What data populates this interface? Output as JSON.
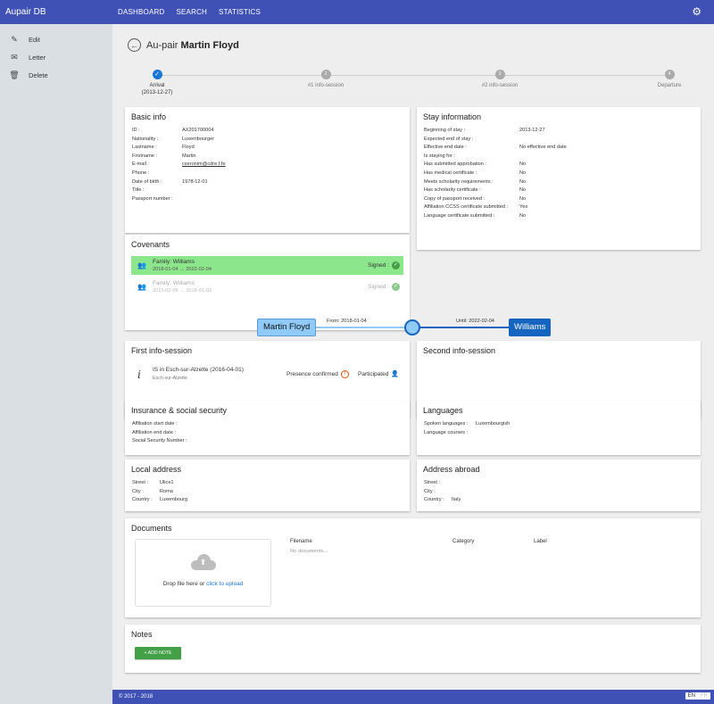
{
  "app": {
    "title": "Aupair DB"
  },
  "nav": [
    "DASHBOARD",
    "SEARCH",
    "STATISTICS"
  ],
  "sidebar": [
    {
      "label": "Edit",
      "icon": "pencil-icon"
    },
    {
      "label": "Letter",
      "icon": "envelope-icon"
    },
    {
      "label": "Delete",
      "icon": "trash-icon"
    }
  ],
  "page": {
    "prefix": "Au-pair",
    "name": "Martin Floyd"
  },
  "steps": [
    {
      "label": "Arrival",
      "sub": "(2013-12-27)",
      "num": "✓",
      "active": true
    },
    {
      "label": "#1 info-session",
      "sub": "",
      "num": "2",
      "active": false
    },
    {
      "label": "#2 info-session",
      "sub": "",
      "num": "3",
      "active": false
    },
    {
      "label": "Departure",
      "sub": "",
      "num": "4",
      "active": false
    }
  ],
  "basic": {
    "title": "Basic info",
    "rows": [
      {
        "k": "ID :",
        "v": "AX201700004"
      },
      {
        "k": "Nationality :",
        "v": "Luxembourger"
      },
      {
        "k": "Lastname :",
        "v": "Floyd"
      },
      {
        "k": "Firstname :",
        "v": "Martin"
      },
      {
        "k": "E-mail :",
        "v": "cseronim@cdre.f.fe",
        "link": true
      },
      {
        "k": "Phone :",
        "v": ""
      },
      {
        "k": "Date of birth :",
        "v": "1978-12-01"
      },
      {
        "k": "Title :",
        "v": ""
      },
      {
        "k": "Passport number :",
        "v": ""
      }
    ]
  },
  "stay": {
    "title": "Stay information",
    "rows": [
      {
        "k": "Beginning of stay :",
        "v": "2013-12-27"
      },
      {
        "k": "Expected end of stay :",
        "v": ""
      },
      {
        "k": "Effective end date :",
        "v": "No effective end date",
        "red": true
      },
      {
        "k": "Is staying for :",
        "v": ""
      },
      {
        "k": "Has submitted approbation :",
        "v": "No",
        "red": true
      },
      {
        "k": "Has medical certificate :",
        "v": "No",
        "red": true
      },
      {
        "k": "Meets scholarity requirements :",
        "v": "No",
        "red": true
      },
      {
        "k": "Has scholarity certificate :",
        "v": "No",
        "red": true
      },
      {
        "k": "Copy of passport received :",
        "v": "No",
        "red": true
      },
      {
        "k": "Affiliation CCSS certificate submitted :",
        "v": "Yes"
      },
      {
        "k": "Language certificate submitted :",
        "v": "No",
        "red": true
      }
    ]
  },
  "covenants": {
    "title": "Covenants",
    "items": [
      {
        "family": "Family: Williams",
        "dates": "2018-01-04 → 2022-02-04",
        "status": "Signed :",
        "active": true
      },
      {
        "family": "Family: Williams",
        "dates": "2015-02-06 → 2018-01-03",
        "status": "Signed :",
        "active": false
      }
    ]
  },
  "timeline": {
    "left": "Martin Floyd",
    "right": "Williams",
    "from": "From: 2018-01-04",
    "until": "Until: 2022-02-04"
  },
  "info1": {
    "title": "First info-session",
    "session": "IS in Esch-sur-Alzette (2016-04-01)",
    "place": "Esch-sur-Alzette",
    "presence": "Presence confirmed",
    "participated": "Participated"
  },
  "info2": {
    "title": "Second info-session"
  },
  "insurance": {
    "title": "Insurance & social security",
    "rows": [
      {
        "k": "Affiliation start date :",
        "v": ""
      },
      {
        "k": "Affiliation end date :",
        "v": ""
      },
      {
        "k": "Social Security Number :",
        "v": ""
      }
    ]
  },
  "languages": {
    "title": "Languages",
    "rows": [
      {
        "k": "Spoken languages :",
        "v": "Luxembourgish"
      },
      {
        "k": "Language courses :",
        "v": ""
      }
    ]
  },
  "local": {
    "title": "Local address",
    "rows": [
      {
        "k": "Street :",
        "v": "Ulice1"
      },
      {
        "k": "City :",
        "v": "Roma"
      },
      {
        "k": "Country :",
        "v": "Luxembourg"
      }
    ]
  },
  "abroad": {
    "title": "Address abroad",
    "rows": [
      {
        "k": "Street :",
        "v": ""
      },
      {
        "k": "City :",
        "v": ""
      },
      {
        "k": "Country :",
        "v": "Italy"
      }
    ]
  },
  "documents": {
    "title": "Documents",
    "drop_text": "Drop file here or",
    "drop_link": "click to upload",
    "headers": [
      "Filename",
      "Category",
      "Label"
    ],
    "empty": "No documents..."
  },
  "notes": {
    "title": "Notes",
    "add": "+ ADD NOTE"
  },
  "footer": {
    "text": "© 2017 - 2018",
    "langs": [
      "EN",
      "FR"
    ]
  },
  "colors": {
    "primary": "#3f51b5",
    "accent": "#1976d2",
    "signed_active": "#8ce68c",
    "negative": "#e53935"
  }
}
